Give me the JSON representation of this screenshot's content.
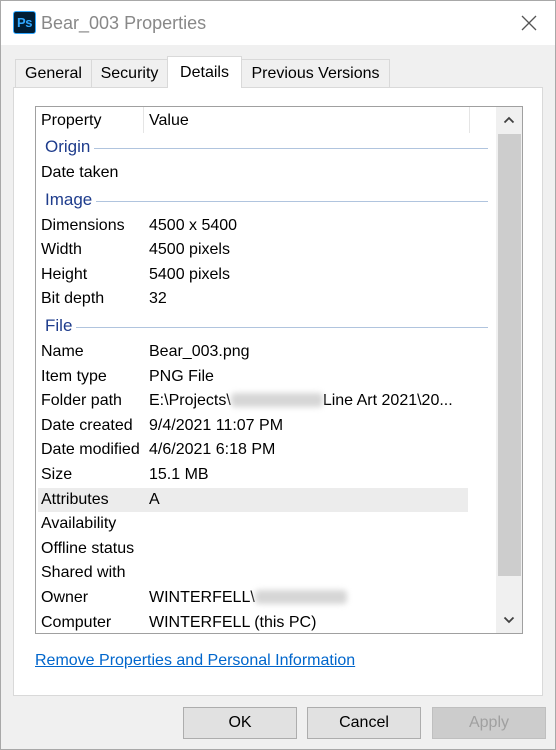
{
  "window": {
    "title": "Bear_003 Properties",
    "app_icon": {
      "name": "photoshop-icon",
      "label": "Ps",
      "bg": "#001e36",
      "fg": "#31a8ff"
    }
  },
  "tabs": [
    {
      "label": "General",
      "active": false
    },
    {
      "label": "Security",
      "active": false
    },
    {
      "label": "Details",
      "active": true
    },
    {
      "label": "Previous Versions",
      "active": false
    }
  ],
  "list": {
    "columns": {
      "property": "Property",
      "value": "Value"
    },
    "groups": [
      {
        "title": "Origin",
        "rows": [
          {
            "property": "Date taken",
            "value": ""
          }
        ]
      },
      {
        "title": "Image",
        "rows": [
          {
            "property": "Dimensions",
            "value": "4500 x 5400"
          },
          {
            "property": "Width",
            "value": "4500 pixels"
          },
          {
            "property": "Height",
            "value": "5400 pixels"
          },
          {
            "property": "Bit depth",
            "value": "32"
          }
        ]
      },
      {
        "title": "File",
        "rows": [
          {
            "property": "Name",
            "value": "Bear_003.png"
          },
          {
            "property": "Item type",
            "value": "PNG File"
          },
          {
            "property": "Folder path",
            "value_prefix": "E:\\Projects\\",
            "value_redacted": true,
            "value_suffix": "Line Art 2021\\20..."
          },
          {
            "property": "Date created",
            "value": "9/4/2021 11:07 PM"
          },
          {
            "property": "Date modified",
            "value": "4/6/2021 6:18 PM"
          },
          {
            "property": "Size",
            "value": "15.1 MB"
          },
          {
            "property": "Attributes",
            "value": "A",
            "selected": true
          },
          {
            "property": "Availability",
            "value": ""
          },
          {
            "property": "Offline status",
            "value": ""
          },
          {
            "property": "Shared with",
            "value": ""
          },
          {
            "property": "Owner",
            "value_prefix": "WINTERFELL\\",
            "value_redacted": true,
            "value_suffix": ""
          },
          {
            "property": "Computer",
            "value": "WINTERFELL (this PC)"
          }
        ]
      }
    ]
  },
  "link": {
    "label": "Remove Properties and Personal Information",
    "color": "#0066cc"
  },
  "buttons": {
    "ok": "OK",
    "cancel": "Cancel",
    "apply": "Apply"
  }
}
